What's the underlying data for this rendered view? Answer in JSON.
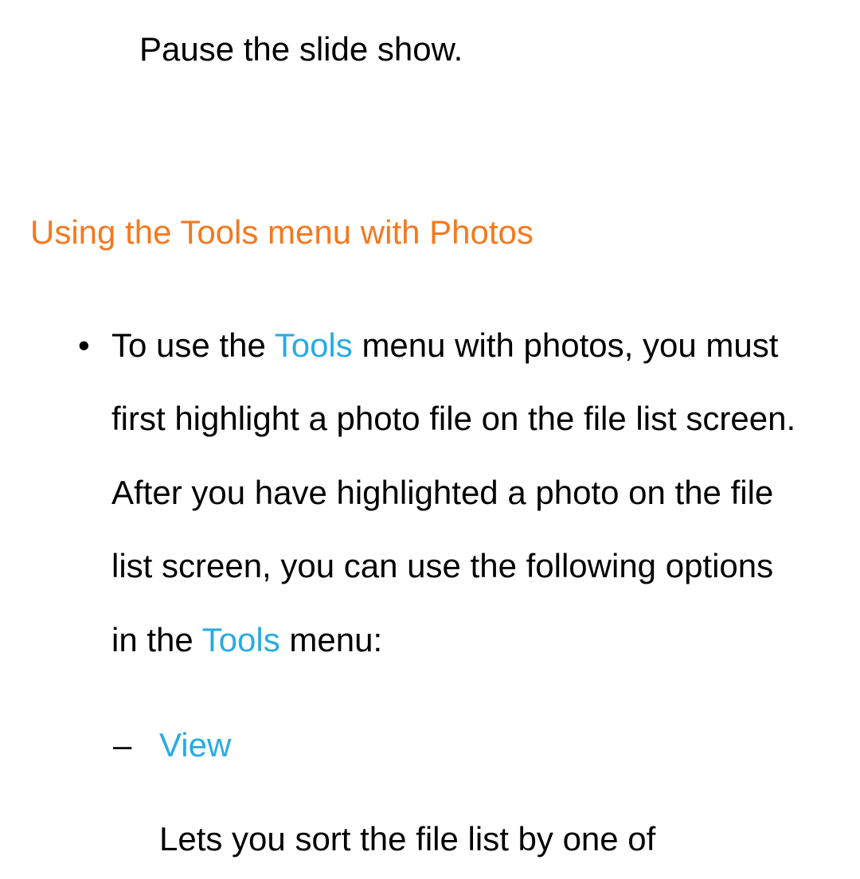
{
  "top_text": "Pause the slide show.",
  "section_heading": "Using the Tools menu with Photos",
  "bullet": {
    "text_before1": "To use the ",
    "highlight1": "Tools",
    "text_after1": " menu with photos, you must first highlight a photo file on the file list screen. After you have highlighted a photo on the file list screen, you can use the following options in the ",
    "highlight2": "Tools",
    "text_after2": " menu:"
  },
  "dash_item": {
    "title": "View",
    "desc": "Lets you sort the file list by one of"
  }
}
